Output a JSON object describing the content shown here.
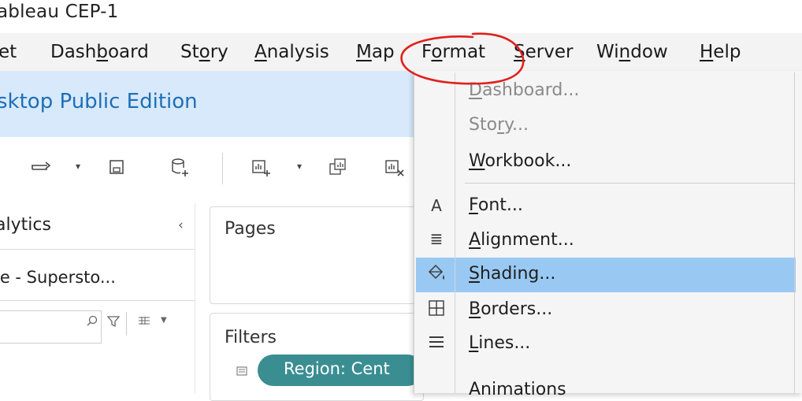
{
  "window": {
    "title": "ableau  CEP-1"
  },
  "menubar": {
    "items": [
      {
        "key": "sheet",
        "pre": "et",
        "ul": "",
        "post": ""
      },
      {
        "key": "dashboard",
        "pre": "Dash",
        "ul": "b",
        "post": "oard"
      },
      {
        "key": "story",
        "pre": "St",
        "ul": "o",
        "post": "ry"
      },
      {
        "key": "analysis",
        "pre": "",
        "ul": "A",
        "post": "nalysis"
      },
      {
        "key": "map",
        "pre": "",
        "ul": "M",
        "post": "ap"
      },
      {
        "key": "format",
        "pre": "F",
        "ul": "o",
        "post": "rmat"
      },
      {
        "key": "server",
        "pre": "",
        "ul": "S",
        "post": "erver"
      },
      {
        "key": "window",
        "pre": "Wi",
        "ul": "n",
        "post": "dow"
      },
      {
        "key": "help",
        "pre": "",
        "ul": "H",
        "post": "elp"
      }
    ]
  },
  "banner": {
    "text": "sktop Public Edition"
  },
  "left_panel": {
    "header": "alytics",
    "collapse": "‹",
    "datasource": "le - Supersto..."
  },
  "pages": {
    "title": "Pages"
  },
  "filters": {
    "title": "Filters",
    "pill": "Region: Cent"
  },
  "format_menu": {
    "items": [
      {
        "key": "dashboard",
        "pre": "",
        "ul": "D",
        "post": "ashboard...",
        "disabled": true,
        "icon": ""
      },
      {
        "key": "story",
        "pre": "Sto",
        "ul": "r",
        "post": "y...",
        "disabled": true,
        "icon": ""
      },
      {
        "key": "workbook",
        "pre": "",
        "ul": "W",
        "post": "orkbook...",
        "disabled": false,
        "icon": ""
      },
      {
        "key": "font",
        "pre": "",
        "ul": "F",
        "post": "ont...",
        "disabled": false,
        "icon": "A"
      },
      {
        "key": "alignment",
        "pre": "",
        "ul": "A",
        "post": "lignment...",
        "disabled": false,
        "icon": "≣"
      },
      {
        "key": "shading",
        "pre": "",
        "ul": "S",
        "post": "hading...",
        "disabled": false,
        "icon": "⛋",
        "highlighted": true
      },
      {
        "key": "borders",
        "pre": "",
        "ul": "B",
        "post": "orders...",
        "disabled": false,
        "icon": "⊞"
      },
      {
        "key": "lines",
        "pre": "",
        "ul": "L",
        "post": "ines...",
        "disabled": false,
        "icon": "≡"
      },
      {
        "key": "animations",
        "pre": "",
        "ul": "",
        "post": "Animations",
        "disabled": false,
        "icon": ""
      }
    ]
  },
  "colors": {
    "banner_bg": "#d7e9fb",
    "banner_text": "#1d6fb8",
    "highlight": "#99c9f3",
    "pill": "#3a8e92",
    "annotation": "#e0201c"
  }
}
